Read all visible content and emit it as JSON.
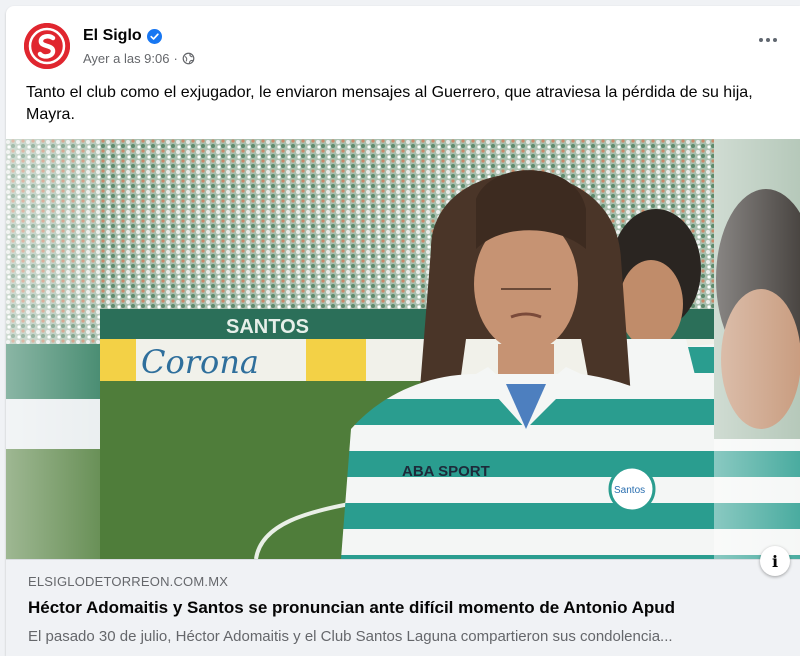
{
  "post": {
    "author": "El Siglo",
    "timestamp": "Ayer a las 9:06",
    "separator": "·",
    "text": "Tanto el club como el exjugador, le enviaron mensajes al Guerrero, que atraviesa la pérdida de su hija, Mayra.",
    "verified_icon": "verified-badge-icon",
    "privacy_icon": "globe-icon"
  },
  "media": {
    "banner_text": "Corona",
    "wall_text": "SANTOS",
    "jersey_sponsor": "ABA SPORT",
    "jersey_crest": "Santos"
  },
  "link": {
    "domain": "ELSIGLODETORREON.COM.MX",
    "title": "Héctor Adomaitis y Santos se pronuncian ante difícil momento de Antonio Apud",
    "description": "El pasado 30 de julio, Héctor Adomaitis y el Club Santos Laguna compartieron sus condolencia..."
  },
  "colors": {
    "brand": "#e0262f",
    "verified": "#1877f2",
    "jersey_green": "#2a9d8f",
    "pitch": "#4f7d3a"
  }
}
